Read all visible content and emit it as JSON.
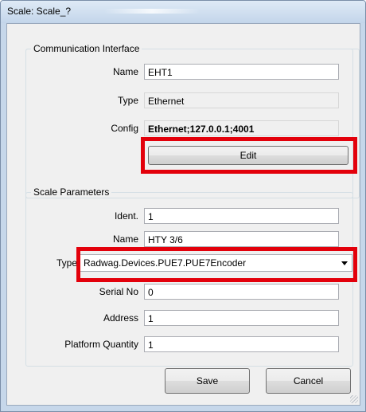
{
  "window": {
    "title": "Scale: Scale_?"
  },
  "communication": {
    "group_title": "Communication Interface",
    "name_label": "Name",
    "name_value": "EHT1",
    "type_label": "Type",
    "type_value": "Ethernet",
    "config_label": "Config",
    "config_value": "Ethernet;127.0.0.1;4001",
    "edit_button": "Edit"
  },
  "scale": {
    "group_title": "Scale Parameters",
    "ident_label": "Ident.",
    "ident_value": "1",
    "name_label": "Name",
    "name_value": "HTY 3/6",
    "type_label": "Type",
    "type_value": "Radwag.Devices.PUE7.PUE7Encoder",
    "serial_label": "Serial No",
    "serial_value": "0",
    "address_label": "Address",
    "address_value": "1",
    "platform_label": "Platform Quantity",
    "platform_value": "1"
  },
  "buttons": {
    "save": "Save",
    "cancel": "Cancel"
  },
  "colors": {
    "highlight": "#e3000b",
    "title_bar": "#c3d5ea"
  }
}
